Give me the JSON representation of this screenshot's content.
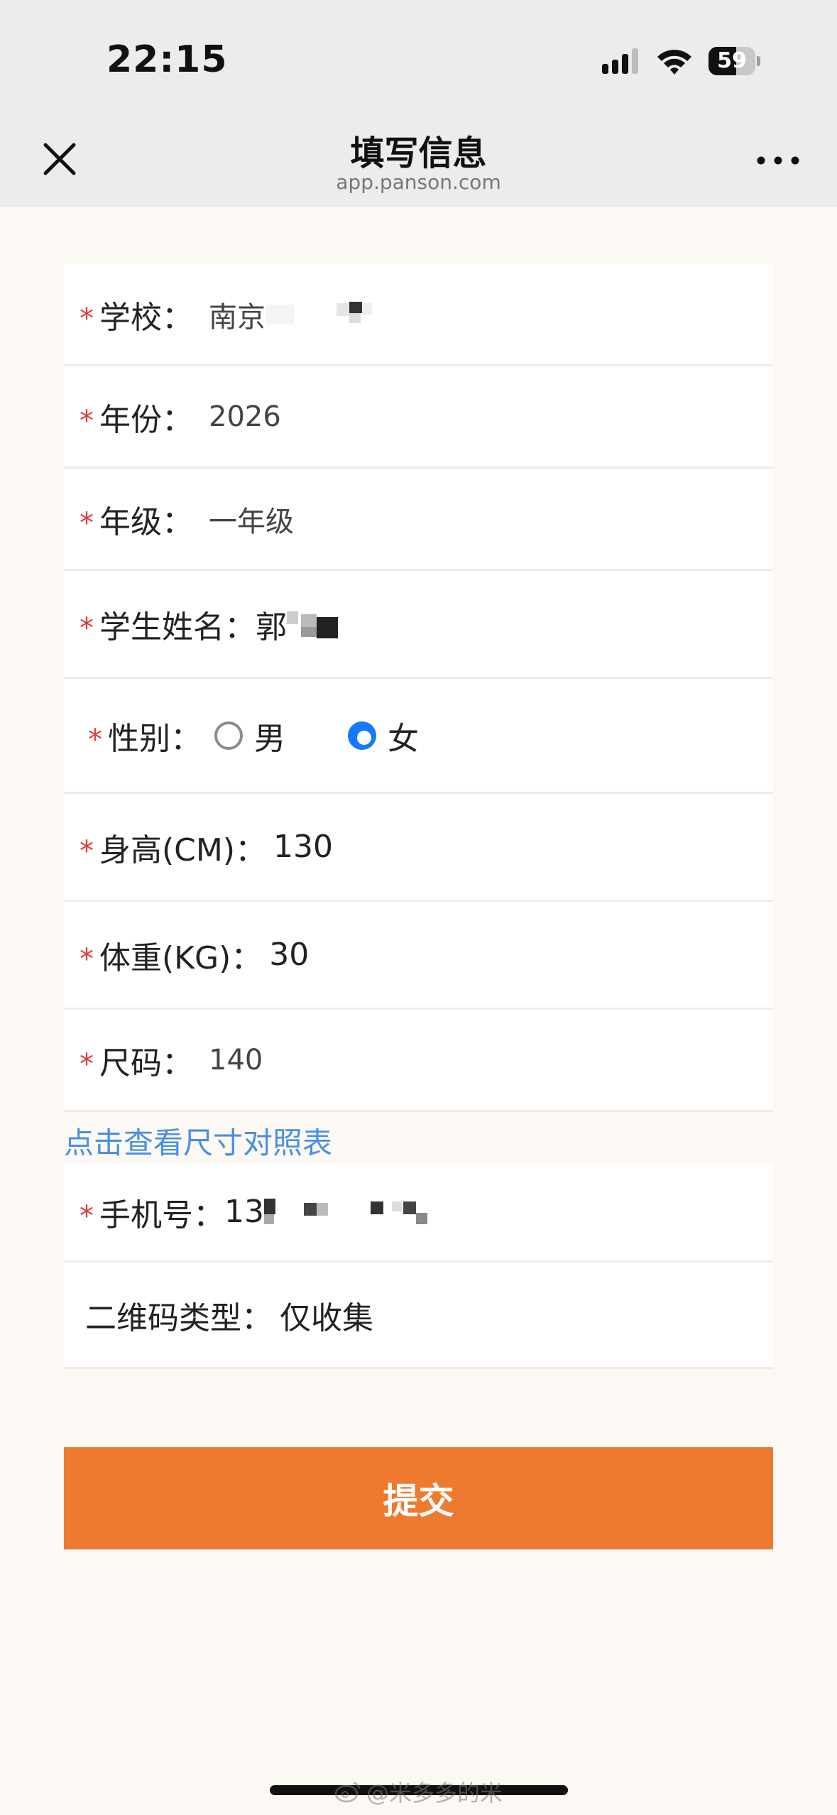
{
  "status_bar": {
    "time": "22:15",
    "battery_percent": 59,
    "battery_text": "59"
  },
  "nav": {
    "title": "填写信息",
    "subtitle": "app.panson.com",
    "close_icon": "close-icon",
    "more_icon": "more-horizontal-icon"
  },
  "form": {
    "required_mark": "*",
    "school": {
      "label": "学校：",
      "value": "南京"
    },
    "year": {
      "label": "年份：",
      "value": "2026"
    },
    "grade": {
      "label": "年级：",
      "value": "一年级"
    },
    "student_name": {
      "label": "学生姓名：",
      "value": "郭"
    },
    "gender": {
      "label": "性别：",
      "options": [
        "男",
        "女"
      ],
      "selected": "女"
    },
    "height": {
      "label": "身高(CM)：",
      "value": "130"
    },
    "weight": {
      "label": "体重(KG)：",
      "value": "30"
    },
    "size": {
      "label": "尺码：",
      "value": "140"
    },
    "size_chart_link": "点击查看尺寸对照表",
    "phone": {
      "label": "手机号：",
      "value": "13"
    },
    "qr_type": {
      "label": "二维码类型：",
      "value": "仅收集"
    }
  },
  "submit_label": "提交",
  "watermark": "@米多多的米",
  "colors": {
    "accent_orange": "#ee7a30",
    "radio_blue": "#1677ff",
    "link_blue": "#4a90e2",
    "required_red": "#e23b3b",
    "page_bg": "#fcf8f4",
    "header_bg": "#ececec"
  }
}
